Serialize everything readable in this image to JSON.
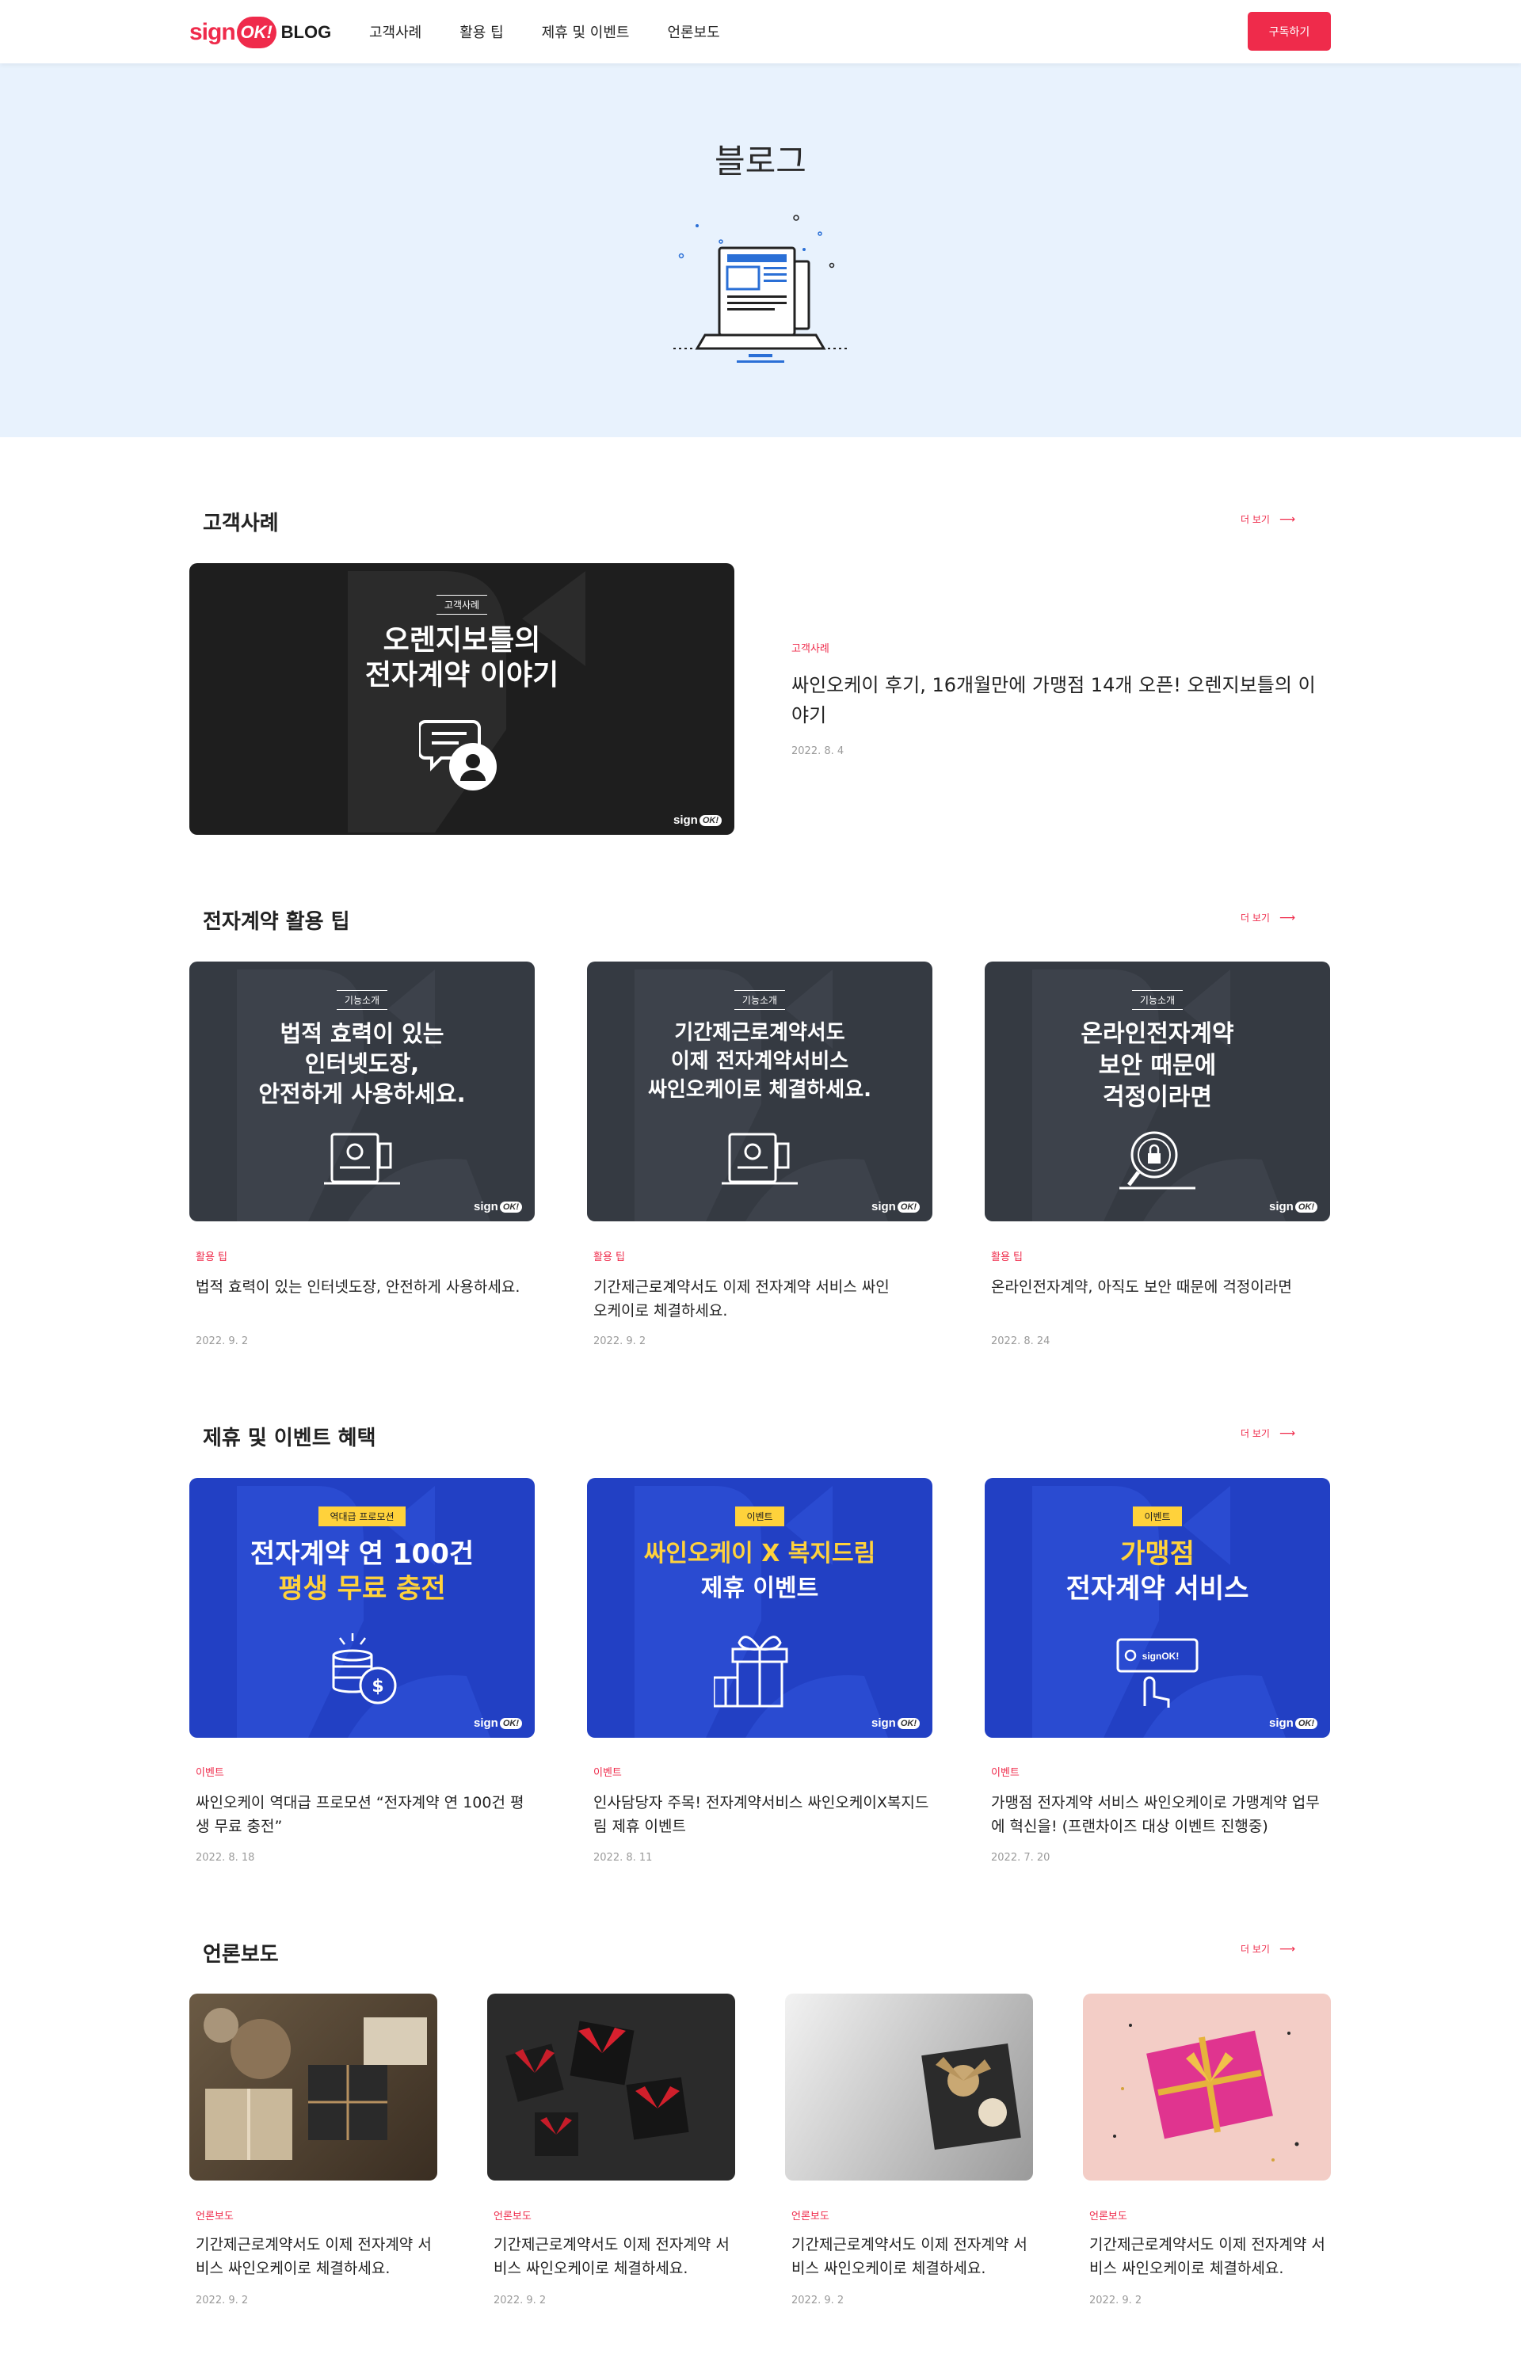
{
  "nav": {
    "logo_sign": "sign",
    "logo_ok": "OK!",
    "logo_blog": "BLOG",
    "links": [
      "고객사례",
      "활용 팁",
      "제휴 및 이벤트",
      "언론보도"
    ],
    "subscribe": "구독하기"
  },
  "hero": {
    "title": "블로그",
    "illustration": "laptop-icon"
  },
  "more_label": "더 보기",
  "sections": {
    "cases": {
      "title": "고객사례",
      "thumb_badge": "고객사례",
      "thumb_line1": "오렌지보틀의",
      "thumb_line2": "전자계약 이야기",
      "category": "고객사례",
      "card_title": "싸인오케이 후기, 16개월만에 가맹점 14개 오픈! 오렌지보틀의 이야기",
      "date": "2022. 8. 4"
    },
    "tips": {
      "title": "전자계약 활용 팁",
      "cards": [
        {
          "badge": "기능소개",
          "lines": [
            "법적 효력이 있는",
            "인터넷도장,",
            "안전하게 사용하세요."
          ],
          "category": "활용 팁",
          "title": "법적 효력이 있는 인터넷도장, 안전하게 사용하세요.",
          "date": "2022. 9. 2"
        },
        {
          "badge": "기능소개",
          "lines": [
            "기간제근로계약서도",
            "이제 전자계약서비스",
            "싸인오케이로 체결하세요."
          ],
          "category": "활용 팁",
          "title": "기간제근로계약서도 이제 전자계약 서비스 싸인오케이로 체결하세요.",
          "date": "2022. 9. 2"
        },
        {
          "badge": "기능소개",
          "lines": [
            "온라인전자계약",
            "보안 때문에",
            "걱정이라면"
          ],
          "category": "활용 팁",
          "title": "온라인전자계약, 아직도 보안 때문에 걱정이라면",
          "date": "2022. 8. 24"
        }
      ]
    },
    "events": {
      "title": "제휴 및 이벤트 혜택",
      "cards": [
        {
          "badge": "역대급 프로모션",
          "lines": [
            "전자계약 연 100건",
            "평생 무료 충전"
          ],
          "category": "이벤트",
          "title": "싸인오케이 역대급 프로모션 “전자계약 연 100건 평생 무료 충전”",
          "date": "2022. 8. 18"
        },
        {
          "badge": "이벤트",
          "lines": [
            "싸인오케이 X 복지드림",
            "제휴 이벤트"
          ],
          "category": "이벤트",
          "title": "인사담당자 주목! 전자계약서비스 싸인오케이X복지드림 제휴 이벤트",
          "date": "2022. 8. 11"
        },
        {
          "badge": "이벤트",
          "lines": [
            "가맹점",
            "전자계약 서비스"
          ],
          "category": "이벤트",
          "title": "가맹점 전자계약 서비스 싸인오케이로 가맹계약 업무에 혁신을! (프랜차이즈 대상 이벤트 진행중)",
          "date": "2022. 7. 20"
        }
      ]
    },
    "press": {
      "title": "언론보도",
      "cards": [
        {
          "category": "언론보도",
          "title": "기간제근로계약서도 이제 전자계약 서비스 싸인오케이로 체결하세요.",
          "date": "2022. 9. 2"
        },
        {
          "category": "언론보도",
          "title": "기간제근로계약서도 이제 전자계약 서비스 싸인오케이로 체결하세요.",
          "date": "2022. 9. 2"
        },
        {
          "category": "언론보도",
          "title": "기간제근로계약서도 이제 전자계약 서비스 싸인오케이로 체결하세요.",
          "date": "2022. 9. 2"
        },
        {
          "category": "언론보도",
          "title": "기간제근로계약서도 이제 전자계약 서비스 싸인오케이로 체결하세요.",
          "date": "2022. 9. 2"
        }
      ]
    }
  },
  "watermark": {
    "sign": "sign",
    "ok": "OK!"
  },
  "colors": {
    "accent": "#ef2b4b",
    "hero_bg": "#e8f2fd",
    "dark_card": "#1e1e1e",
    "tip_card": "#353a42",
    "event_card": "#2240c4",
    "event_yellow": "#ffd23b"
  }
}
